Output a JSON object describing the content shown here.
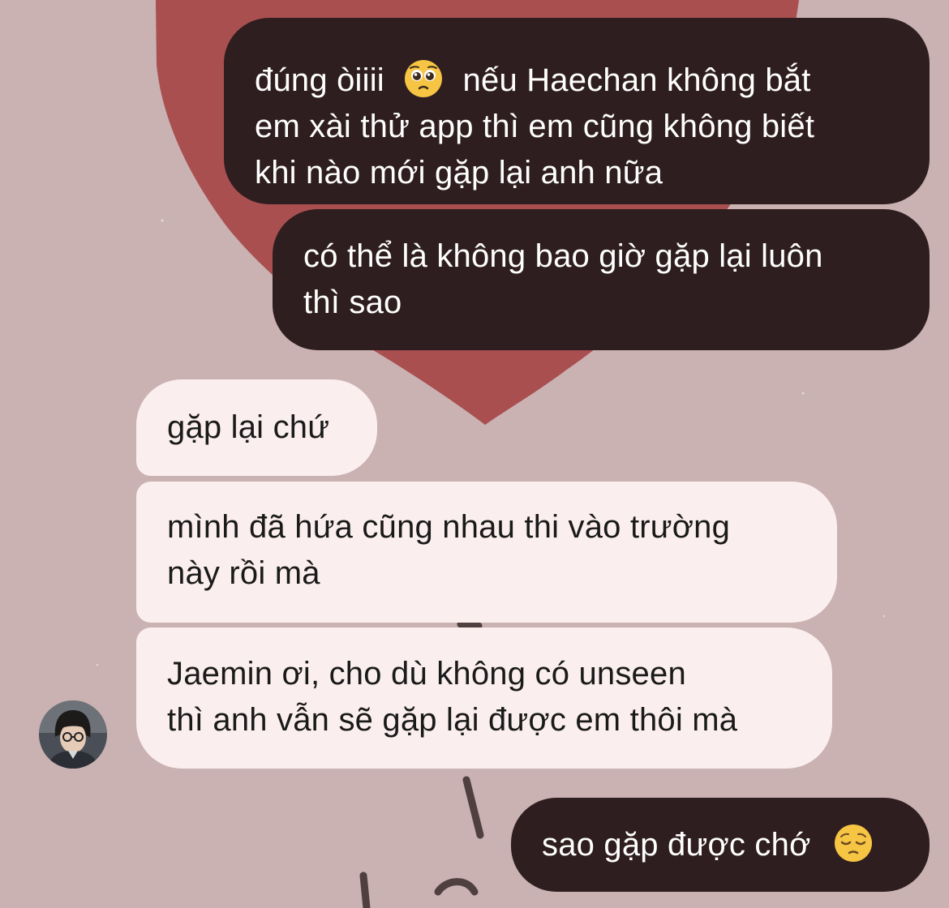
{
  "conversation": {
    "messages": [
      {
        "direction": "outgoing",
        "lines": [
          "đúng òiiii",
          "nếu Haechan không bắt",
          "em xài thử app thì em cũng không biết",
          "khi nào mới gặp lại anh nữa"
        ],
        "emoji": "pleading-face"
      },
      {
        "direction": "outgoing",
        "lines": [
          "có thể là không bao giờ gặp lại luôn",
          "thì sao"
        ]
      },
      {
        "direction": "incoming",
        "lines": [
          "gặp lại chứ"
        ]
      },
      {
        "direction": "incoming",
        "lines": [
          "mình đã hứa cũng nhau thi vào trường",
          "này rồi mà"
        ]
      },
      {
        "direction": "incoming",
        "lines": [
          "Jaemin ơi, cho dù không có unseen",
          "thì anh vẫn sẽ gặp lại được em thôi mà"
        ]
      },
      {
        "direction": "outgoing",
        "lines": [
          "sao gặp được chớ"
        ],
        "emoji": "pensive-face"
      }
    ]
  },
  "colors": {
    "background": "#c9b2b1",
    "heart": "#a94f50",
    "outgoing_bubble": "#2f1e1f",
    "incoming_bubble": "#fbeeee"
  }
}
